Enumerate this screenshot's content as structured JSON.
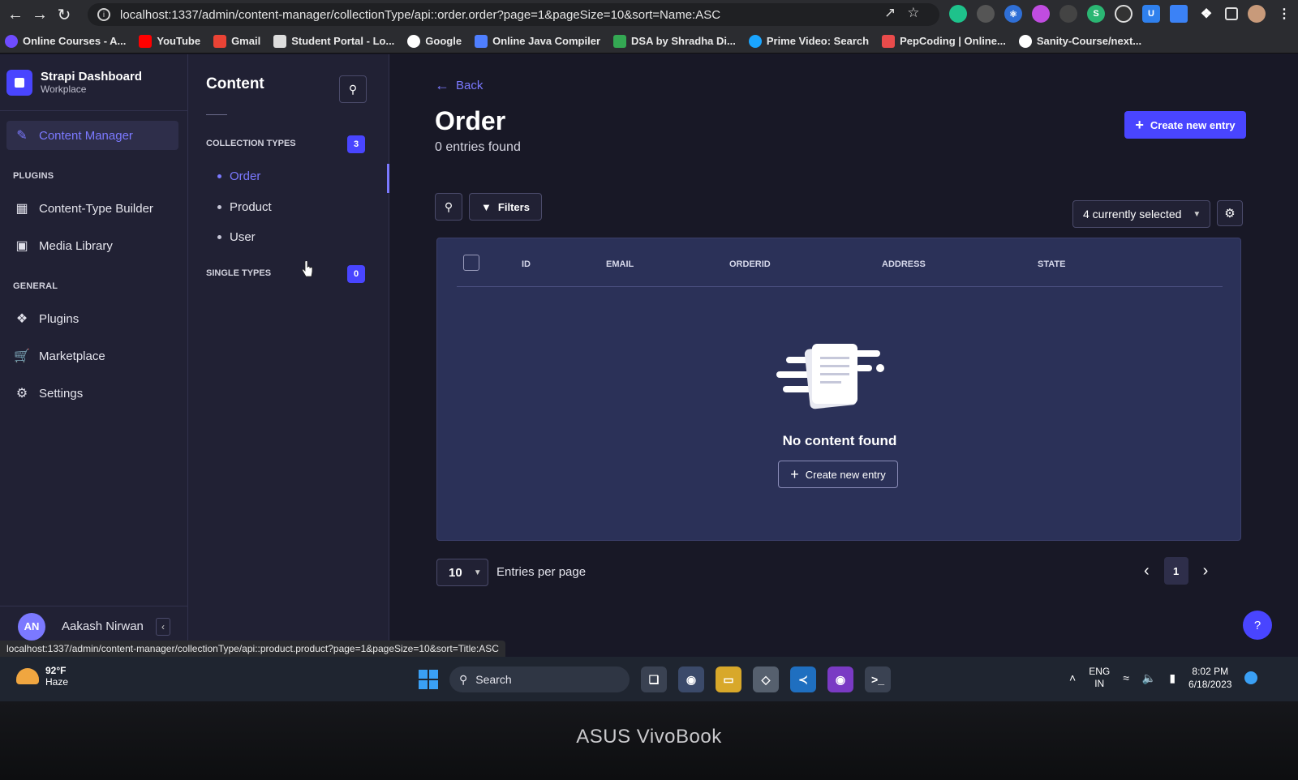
{
  "browser": {
    "url": "localhost:1337/admin/content-manager/collectionType/api::order.order?page=1&pageSize=10&sort=Name:ASC",
    "status_url": "localhost:1337/admin/content-manager/collectionType/api::product.product?page=1&pageSize=10&sort=Title:ASC",
    "bookmarks": [
      {
        "label": "Online Courses - A...",
        "color": "#6f4cff"
      },
      {
        "label": "YouTube",
        "color": "#ff0000"
      },
      {
        "label": "Gmail",
        "color": "#ea4335"
      },
      {
        "label": "Student Portal - Lo...",
        "color": "#ffffff"
      },
      {
        "label": "Google",
        "color": "#ffffff"
      },
      {
        "label": "Online Java Compiler",
        "color": "#4f7fff"
      },
      {
        "label": "DSA by Shradha Di...",
        "color": "#34a853"
      },
      {
        "label": "Prime Video: Search",
        "color": "#1aa5ff"
      },
      {
        "label": "PepCoding | Online...",
        "color": "#e94b4b"
      },
      {
        "label": "Sanity-Course/next...",
        "color": "#ffffff"
      }
    ]
  },
  "mainnav": {
    "brand_title": "Strapi Dashboard",
    "brand_sub": "Workplace",
    "active_item": "Content Manager",
    "plugins_heading": "PLUGINS",
    "content_type_builder": "Content-Type Builder",
    "media_library": "Media Library",
    "general_heading": "GENERAL",
    "plugins": "Plugins",
    "marketplace": "Marketplace",
    "settings": "Settings",
    "user_initials": "AN",
    "user_name": "Aakash Nirwan"
  },
  "subnav": {
    "title": "Content",
    "collection_types_heading": "COLLECTION TYPES",
    "collection_types_count": "3",
    "collection_types": [
      "Order",
      "Product",
      "User"
    ],
    "single_types_heading": "SINGLE TYPES",
    "single_types_count": "0"
  },
  "main": {
    "back_label": "Back",
    "title": "Order",
    "entries_found": "0 entries found",
    "create_label": "Create new entry",
    "filters_label": "Filters",
    "columns_selected": "4 currently selected",
    "columns": [
      "ID",
      "EMAIL",
      "ORDERID",
      "ADDRESS",
      "STATE"
    ],
    "empty_text": "No content found",
    "empty_create_label": "Create new entry",
    "page_size": "10",
    "entries_per_page_label": "Entries per page",
    "current_page": "1",
    "help_label": "?"
  },
  "taskbar": {
    "temp": "92°F",
    "weather": "Haze",
    "search_label": "Search",
    "lang_top": "ENG",
    "lang_bottom": "IN",
    "time": "8:02 PM",
    "date": "6/18/2023"
  },
  "laptop_brand": "ASUS VivoBook",
  "colors": {
    "accent": "#4945ff",
    "accent_text": "#7b79ff",
    "nav_bg": "#212134",
    "page_bg": "#181826"
  }
}
